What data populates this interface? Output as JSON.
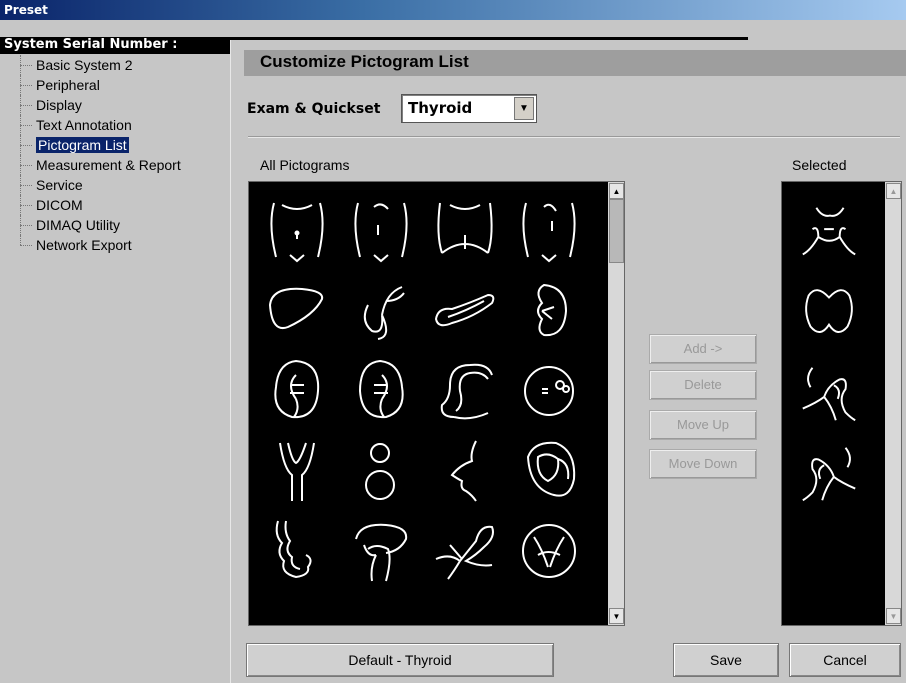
{
  "window": {
    "title": "Preset"
  },
  "serial": {
    "label": "System Serial Number :"
  },
  "tree": {
    "items": [
      {
        "label": "Basic System 2"
      },
      {
        "label": "Peripheral"
      },
      {
        "label": "Display"
      },
      {
        "label": "Text Annotation"
      },
      {
        "label": "Pictogram List",
        "selected": true
      },
      {
        "label": "Measurement & Report"
      },
      {
        "label": "Service"
      },
      {
        "label": "DICOM"
      },
      {
        "label": "DIMAQ Utility"
      },
      {
        "label": "Network Export"
      }
    ]
  },
  "main": {
    "title": "Customize Pictogram List",
    "exam_label": "Exam & Quickset",
    "exam_value": "Thyroid",
    "all_label": "All Pictograms",
    "selected_label": "Selected"
  },
  "all_pictograms": [
    "abdomen-front-icon",
    "abdomen-side-icon",
    "abdomen-lower-icon",
    "abdomen-side2-icon",
    "liver-icon",
    "gallbladder-icon",
    "pancreas-icon",
    "kidney-icon",
    "kidney-left-icon",
    "kidney-right-icon",
    "colon-icon",
    "bladder-icon",
    "aorta-icon",
    "ovary-icon",
    "face-profile-icon",
    "heart-icon",
    "intestine-icon",
    "spleen-icon",
    "vessels-icon",
    "heart-valve-icon"
  ],
  "selected_pictograms": [
    "neck-front-icon",
    "thyroid-icon",
    "neck-left-icon",
    "neck-right-icon"
  ],
  "actions": {
    "add": "Add ->",
    "delete": "Delete",
    "move_up": "Move Up",
    "move_down": "Move Down"
  },
  "footer": {
    "default": "Default - Thyroid",
    "save": "Save",
    "cancel": "Cancel"
  },
  "colors": {
    "selection": "#0a246a",
    "list_bg": "#000000",
    "stroke": "#ffffff"
  }
}
